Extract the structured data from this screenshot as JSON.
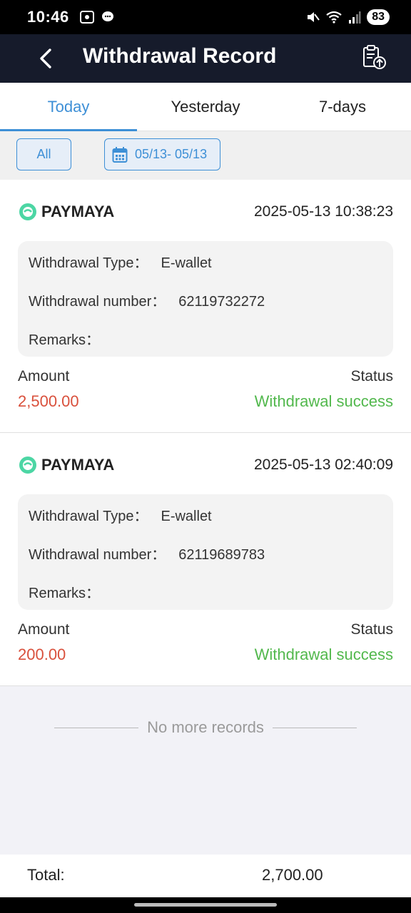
{
  "status_bar": {
    "time": "10:46",
    "battery": "83"
  },
  "header": {
    "title": "Withdrawal Record"
  },
  "tabs": [
    {
      "label": "Today",
      "active": true
    },
    {
      "label": "Yesterday",
      "active": false
    },
    {
      "label": "7-days",
      "active": false
    }
  ],
  "filters": {
    "all_label": "All",
    "date_range": "05/13- 05/13"
  },
  "records": [
    {
      "brand": "PAYMAYA",
      "datetime": "2025-05-13 10:38:23",
      "type_label": "Withdrawal Type：",
      "type_value": "E-wallet",
      "number_label": "Withdrawal number：",
      "number_value": "62119732272",
      "remarks_label": "Remarks：",
      "amount_label": "Amount",
      "amount": "2,500.00",
      "status_label": "Status",
      "status": "Withdrawal success"
    },
    {
      "brand": "PAYMAYA",
      "datetime": "2025-05-13 02:40:09",
      "type_label": "Withdrawal Type：",
      "type_value": "E-wallet",
      "number_label": "Withdrawal number：",
      "number_value": "62119689783",
      "remarks_label": "Remarks：",
      "amount_label": "Amount",
      "amount": "200.00",
      "status_label": "Status",
      "status": "Withdrawal success"
    }
  ],
  "no_more": "No more records",
  "footer": {
    "total_label": "Total:",
    "total_value": "2,700.00"
  },
  "colors": {
    "accent": "#3d8fd6",
    "amount": "#d9503c",
    "success": "#52b84d",
    "header_bg": "#161b2b"
  },
  "icons": [
    "back-arrow-icon",
    "export-clipboard-icon",
    "calendar-icon",
    "paymaya-logo-icon"
  ]
}
